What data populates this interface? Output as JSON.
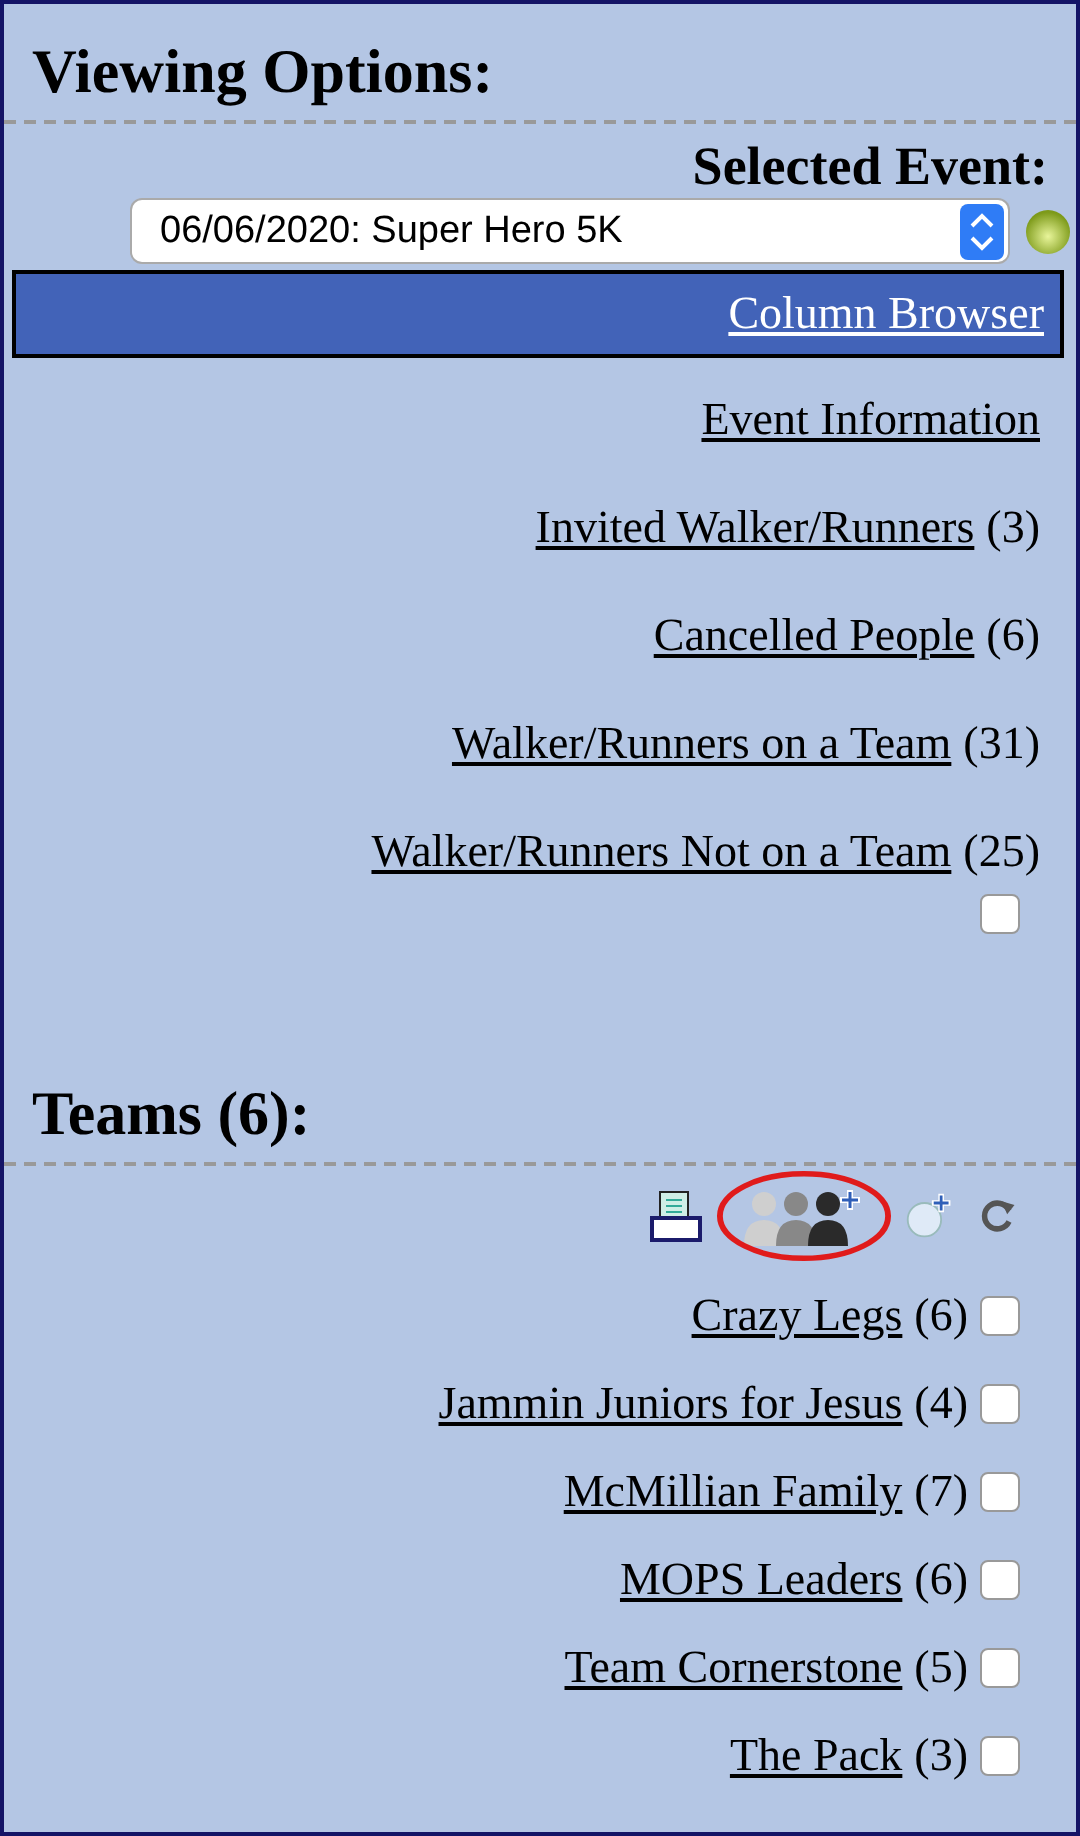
{
  "title": "Viewing Options:",
  "event_selector": {
    "label": "Selected Event:",
    "value": "06/06/2020: Super Hero 5K"
  },
  "views": [
    {
      "label": "Column Browser",
      "selected": true
    },
    {
      "label": "Event Information",
      "selected": false
    },
    {
      "label": "Invited Walker/Runners",
      "count": "(3)",
      "selected": false
    },
    {
      "label": "Cancelled People",
      "count": "(6)",
      "selected": false
    },
    {
      "label": "Walker/Runners on a Team",
      "count": "(31)",
      "selected": false
    },
    {
      "label": "Walker/Runners Not on a Team",
      "count": "(25)",
      "selected": false
    }
  ],
  "views_checkbox": {
    "checked": false
  },
  "teams_heading": "Teams (6):",
  "toolbar": [
    {
      "kind": "print",
      "circled": false
    },
    {
      "kind": "add-people",
      "circled": true
    },
    {
      "kind": "add-globe",
      "circled": false
    },
    {
      "kind": "refresh",
      "circled": false
    }
  ],
  "teams": [
    {
      "name": "Crazy Legs",
      "count": "(6)",
      "checked": false
    },
    {
      "name": "Jammin Juniors for Jesus",
      "count": "(4)",
      "checked": false
    },
    {
      "name": "McMillian Family",
      "count": "(7)",
      "checked": false
    },
    {
      "name": "MOPS Leaders",
      "count": "(6)",
      "checked": false
    },
    {
      "name": "Team Cornerstone",
      "count": "(5)",
      "checked": false
    },
    {
      "name": "The Pack",
      "count": "(3)",
      "checked": false
    }
  ]
}
